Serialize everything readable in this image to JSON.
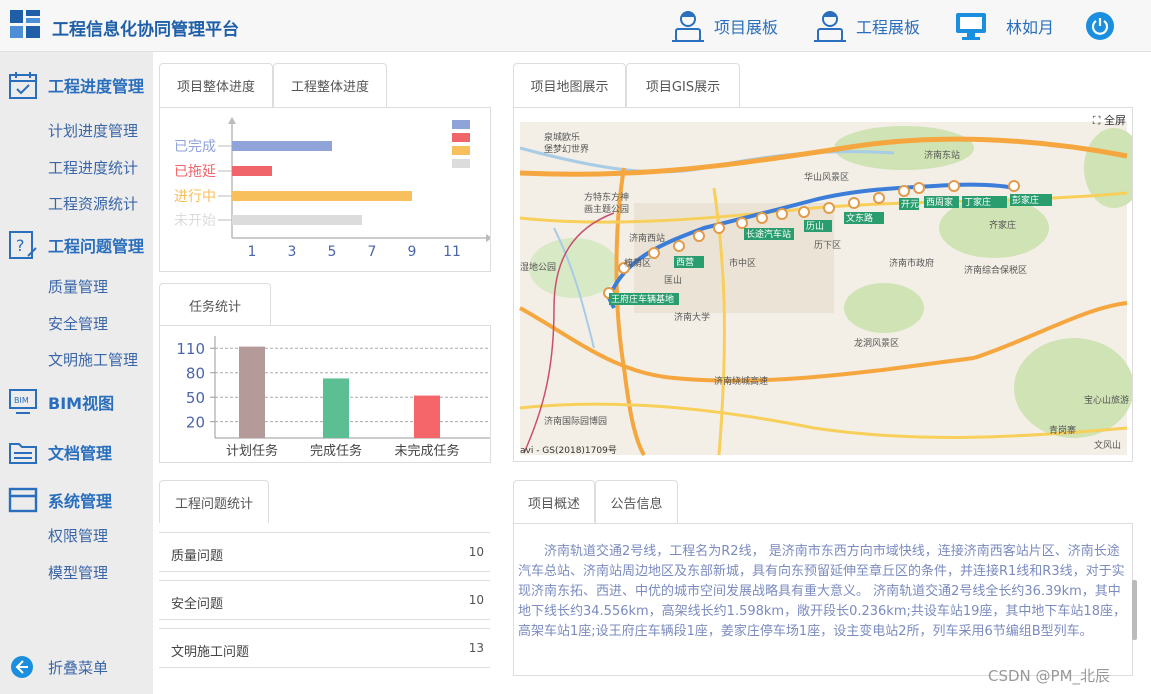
{
  "header": {
    "title": "工程信息化协同管理平台",
    "nav": [
      {
        "label": "项目展板",
        "icon": "engineer-icon"
      },
      {
        "label": "工程展板",
        "icon": "engineer-icon"
      },
      {
        "label": "林如月",
        "icon": "monitor-icon"
      }
    ],
    "power_icon": "power-icon"
  },
  "sidebar": {
    "groups": [
      {
        "label": "工程进度管理",
        "icon": "calendar-check-icon",
        "items": [
          "计划进度管理",
          "工程进度统计",
          "工程资源统计"
        ]
      },
      {
        "label": "工程问题管理",
        "icon": "question-doc-icon",
        "items": [
          "质量管理",
          "安全管理",
          "文明施工管理"
        ]
      },
      {
        "label": "BIM视图",
        "icon": "bim-monitor-icon",
        "items": []
      },
      {
        "label": "文档管理",
        "icon": "folder-icon",
        "items": []
      },
      {
        "label": "系统管理",
        "icon": "window-icon",
        "items": [
          "权限管理",
          "模型管理"
        ]
      }
    ],
    "collapse_label": "折叠菜单"
  },
  "progress_panel": {
    "tabs": [
      "项目整体进度",
      "工程整体进度"
    ],
    "chart_data": {
      "type": "bar",
      "orientation": "horizontal",
      "categories": [
        "已完成",
        "已拖延",
        "进行中",
        "未开始"
      ],
      "values": [
        5,
        2,
        9,
        6.5
      ],
      "colors": [
        "#8fa3d8",
        "#f0656a",
        "#f7c05c",
        "#dcdcdc"
      ],
      "xticks": [
        "1",
        "3",
        "5",
        "7",
        "9",
        "11"
      ],
      "xlim": [
        0,
        12.5
      ],
      "legend": "top-right"
    }
  },
  "task_panel": {
    "tab": "任务统计",
    "chart_data": {
      "type": "bar",
      "categories": [
        "计划任务",
        "完成任务",
        "未完成任务"
      ],
      "values": [
        112,
        73,
        52
      ],
      "colors": [
        "#b59a9a",
        "#5cbf93",
        "#f5666a"
      ],
      "yticks": [
        "20",
        "50",
        "80",
        "110"
      ],
      "ylim": [
        0,
        125
      ],
      "grid": true
    }
  },
  "issue_panel": {
    "tab": "工程问题统计",
    "rows": [
      {
        "name": "质量问题",
        "count": "10"
      },
      {
        "name": "安全问题",
        "count": "10"
      },
      {
        "name": "文明施工问题",
        "count": "13"
      }
    ]
  },
  "map_panel": {
    "tabs": [
      "项目地图展示",
      "项目GIS展示"
    ],
    "fullscreen_label": "全屏",
    "place_labels": [
      "泉城欧乐堡梦幻世界",
      "济南东站",
      "华山风景区",
      "方特东方神画主题公园",
      "济南西站",
      "济南市政府",
      "济南大学",
      "龙洞风景区",
      "济南国际园博园",
      "济南绕城高速",
      "湿地公园",
      "济南综合保税区",
      "齐家庄",
      "章丘",
      "历城区",
      "历下区",
      "市中区",
      "槐荫区",
      "天桥区",
      "青岗寨",
      "文风山",
      "宝心山旅游"
    ],
    "station_labels": [
      "王府庄车辆基地",
      "西营",
      "济南西",
      "历山路",
      "长途汽车站",
      "济南站",
      "山大路",
      "历山公园",
      "文东路",
      "开元寺",
      "西周家庄",
      "丁家庄",
      "彭家庄",
      "姜家庄",
      "彭家庄"
    ],
    "copyright": "avi - GS(2018)1709号"
  },
  "overview_panel": {
    "tabs": [
      "项目概述",
      "公告信息"
    ],
    "text": "济南轨道交通2号线，工程名为R2线， 是济南市东西方向市域快线，连接济南西客站片区、济南长途汽车总站、济南站周边地区及东部新城，具有向东预留延伸至章丘区的条件，并连接R1线和R3线，对于实现济南东拓、西进、中优的城市空间发展战略具有重大意义。 济南轨道交通2号线全长约36.39km，其中地下线长约34.556km，高架线长约1.598km，敞开段长0.236km;共设车站19座，其中地下车站18座，高架车站1座;设王府庄车辆段1座，姜家庄停车场1座，设主变电站2所，列车采用6节编组B型列车。"
  },
  "watermark": "CSDN @PM_北辰"
}
